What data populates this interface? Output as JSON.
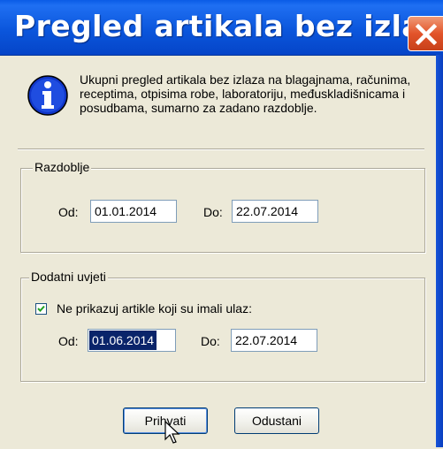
{
  "window": {
    "title": "Pregled artikala bez izlaza",
    "close_icon": "close-icon"
  },
  "info": {
    "icon": "info-icon",
    "text": "Ukupni pregled artikala bez izlaza na blagajnama, računima, receptima, otpisima robe, laboratoriju, međuskladišnicama i posudbama, sumarno za zadano razdoblje."
  },
  "razdoblje": {
    "legend": "Razdoblje",
    "od_label": "Od:",
    "od_value": "01.01.2014",
    "do_label": "Do:",
    "do_value": "22.07.2014"
  },
  "dodatni": {
    "legend": "Dodatni uvjeti",
    "checkbox_label": "Ne prikazuj artikle koji su imali ulaz:",
    "checkbox_checked": true,
    "od_label": "Od:",
    "od_value": "01.06.2014",
    "do_label": "Do:",
    "do_value": "22.07.2014"
  },
  "buttons": {
    "accept": "Prihvati",
    "cancel": "Odustani"
  },
  "colors": {
    "titlebar": "#0b56dc",
    "dialog_bg": "#ECE9D8",
    "selection": "#0a246a",
    "close": "#e2542a"
  }
}
